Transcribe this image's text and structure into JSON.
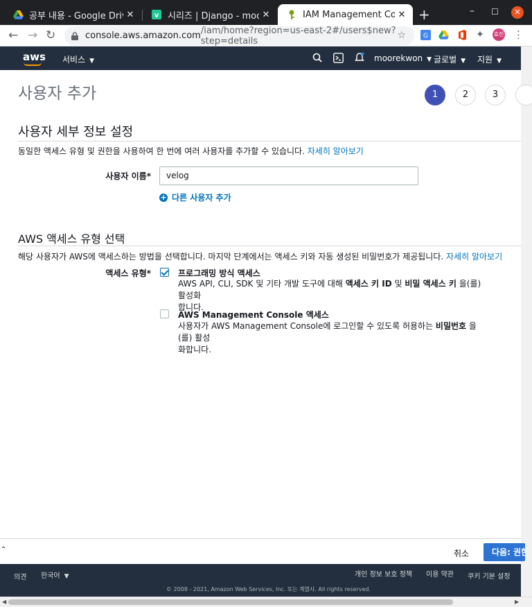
{
  "browser": {
    "tabs": [
      {
        "title": "공부 내용 - Google Drive",
        "icon": "google-drive-icon"
      },
      {
        "title": "시리즈 | Django - moorekw",
        "icon": "velog-icon"
      },
      {
        "title": "IAM Management Conso",
        "icon": "aws-iam-icon"
      }
    ],
    "url_host": "console.aws.amazon.com",
    "url_rest": "/iam/home?region=us-east-2#/users$new?step=details",
    "profile_initials": "효진"
  },
  "aws_nav": {
    "logo": "aws",
    "services": "서비스",
    "account": "moorekwon",
    "region": "글로벌",
    "support": "지원"
  },
  "page": {
    "title": "사용자 추가",
    "steps": [
      "1",
      "2",
      "3"
    ]
  },
  "details": {
    "heading": "사용자 세부 정보 설정",
    "description": "동일한 액세스 유형 및 권한을 사용하여 한 번에 여러 사용자를 추가할 수 있습니다.",
    "learn_more": "자세히 알아보기",
    "username_label": "사용자 이름*",
    "username_value": "velog",
    "add_another": "다른 사용자 추가"
  },
  "access": {
    "heading": "AWS 액세스 유형 선택",
    "description": "해당 사용자가 AWS에 액세스하는 방법을 선택합니다. 마지막 단계에서는 액세스 키와 자동 생성된 비밀번호가 제공됩니다.",
    "learn_more": "자세히 알아보기",
    "type_label": "액세스 유형*",
    "options": [
      {
        "title": "프로그래밍 방식 액세스",
        "checked": true,
        "desc_a": "AWS API, CLI, SDK 및 기타 개발 도구에 대해 ",
        "desc_b1": "액세스 키 ID",
        "desc_mid": " 및 ",
        "desc_b2": "비밀 액세스 키",
        "desc_c": " 을(를) 활성화",
        "desc_d": "합니다."
      },
      {
        "title": "AWS Management Console 액세스",
        "checked": false,
        "desc_a": "사용자가 AWS Management Console에 로그인할 수 있도록 허용하는 ",
        "desc_b1": "비밀번호",
        "desc_c": " 을(를) 활성",
        "desc_d": "화합니다."
      }
    ]
  },
  "actions": {
    "cancel": "취소",
    "next": "다음: 권한"
  },
  "footer": {
    "feedback": "의견",
    "language": "한국어",
    "privacy": "개인 정보 보호 정책",
    "terms": "이용 약관",
    "cookies": "쿠키 기본 설정",
    "copyright": "© 2008 - 2021, Amazon Web Services, Inc. 또는 계열사. All rights reserved."
  }
}
